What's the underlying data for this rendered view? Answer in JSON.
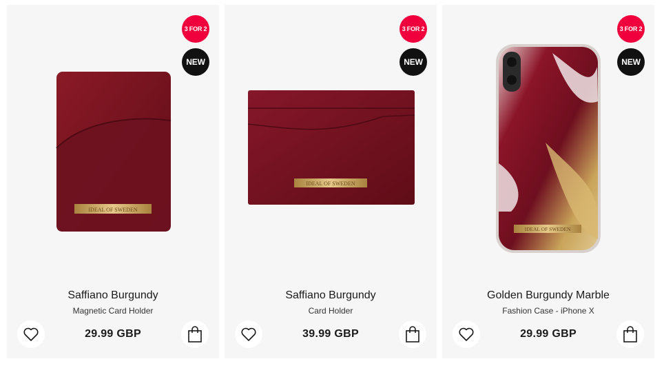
{
  "products": [
    {
      "badge_sale": "3 FOR 2",
      "badge_new": "NEW",
      "name": "Saffiano Burgundy",
      "type": "Magnetic Card Holder",
      "price": "29.99 GBP",
      "logo_text": "IDEAL OF SWEDEN",
      "image_icon": "magnetic-card-holder-image"
    },
    {
      "badge_sale": "3 FOR 2",
      "badge_new": "NEW",
      "name": "Saffiano Burgundy",
      "type": "Card Holder",
      "price": "39.99 GBP",
      "logo_text": "IDEAL OF SWEDEN",
      "image_icon": "card-holder-image"
    },
    {
      "badge_sale": "3 FOR 2",
      "badge_new": "NEW",
      "name": "Golden Burgundy Marble",
      "type": "Fashion Case - iPhone X",
      "price": "29.99 GBP",
      "logo_text": "IDEAL OF SWEDEN",
      "image_icon": "phone-case-image"
    }
  ],
  "icons": {
    "wishlist": "heart-icon",
    "cart": "shopping-bag-icon"
  },
  "colors": {
    "sale_badge": "#f0003c",
    "new_badge": "#111111",
    "burgundy": "#7a1020",
    "gold": "#c9a45a"
  }
}
